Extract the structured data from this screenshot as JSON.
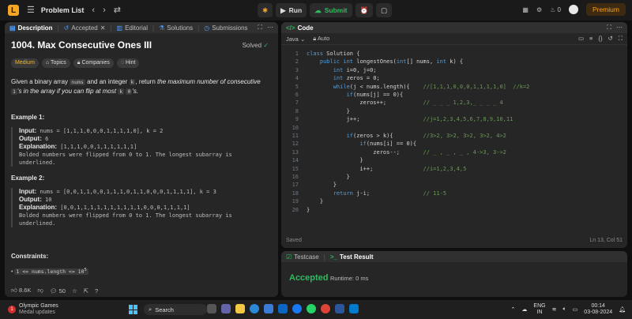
{
  "topbar": {
    "title": "Problem List",
    "run": "Run",
    "submit": "Submit",
    "streak": "0",
    "premium": "Premium"
  },
  "left": {
    "tabs": [
      "Description",
      "Accepted",
      "Editorial",
      "Solutions",
      "Submissions"
    ],
    "title": "1004. Max Consecutive Ones III",
    "solved": "Solved",
    "tags": [
      "Medium",
      "Topics",
      "Companies",
      "Hint"
    ],
    "desc_parts": [
      "Given a binary array ",
      "nums",
      " and an integer ",
      "k",
      ", return ",
      "the maximum number of consecutive ",
      "1",
      "'s in the array if you can flip at most ",
      "k",
      " ",
      "0",
      "'s."
    ],
    "ex1": {
      "head": "Example 1:",
      "input_label": "Input:",
      "input": "nums = [1,1,1,0,0,0,1,1,1,1,0], k = 2",
      "output_label": "Output:",
      "output": "6",
      "expl_label": "Explanation:",
      "expl": "[1,1,1,0,0,1,1,1,1,1,1]",
      "note": "Bolded numbers were flipped from 0 to 1. The longest subarray is underlined."
    },
    "ex2": {
      "head": "Example 2:",
      "input_label": "Input:",
      "input": "nums = [0,0,1,1,0,0,1,1,1,0,1,1,0,0,0,1,1,1,1], k = 3",
      "output_label": "Output:",
      "output": "10",
      "expl_label": "Explanation:",
      "expl": "[0,0,1,1,1,1,1,1,1,1,1,1,0,0,0,1,1,1,1]",
      "note": "Bolded numbers were flipped from 0 to 1. The longest subarray is underlined."
    },
    "constraints_head": "Constraints:",
    "constraint1": "1 <= nums.length <= 10",
    "constraint1_exp": "5",
    "likes": "8.6K",
    "comments": "50"
  },
  "code": {
    "title": "Code",
    "lang": "Java",
    "auto": "Auto",
    "lines": [
      {
        "n": "1",
        "t": "class Solution {"
      },
      {
        "n": "2",
        "t": "    public int longestOnes(int[] nums, int k) {"
      },
      {
        "n": "3",
        "t": "        int i=0, j=0;"
      },
      {
        "n": "4",
        "t": "        int zeros = 0;"
      },
      {
        "n": "5",
        "t": "        while(j < nums.length){    //[1,1,1,0,0,0,1,1,1,1,0]  //k=2"
      },
      {
        "n": "6",
        "t": "            if(nums[j] == 0){"
      },
      {
        "n": "7",
        "t": "                zeros++;           // _ _ _ 1,2,3,_ _ _ _ 4"
      },
      {
        "n": "8",
        "t": "            }"
      },
      {
        "n": "9",
        "t": "            j++;                   //j=1,2,3,4,5,6,7,8,9,10,11"
      },
      {
        "n": "10",
        "t": ""
      },
      {
        "n": "11",
        "t": "            if(zeros > k){         //3>2, 3>2, 3>2, 3>2, 4>2"
      },
      {
        "n": "12",
        "t": "                if(nums[i] == 0){"
      },
      {
        "n": "13",
        "t": "                    zeros--;       // _ , _ , _ , 4->3, 3->2"
      },
      {
        "n": "14",
        "t": "                }"
      },
      {
        "n": "15",
        "t": "                i++;               //i=1,2,3,4,5"
      },
      {
        "n": "16",
        "t": "            }"
      },
      {
        "n": "17",
        "t": "        }"
      },
      {
        "n": "18",
        "t": "        return j-i;                // 11-5"
      },
      {
        "n": "19",
        "t": "    }"
      },
      {
        "n": "20",
        "t": "}"
      }
    ],
    "saved": "Saved",
    "cursor": "Ln 13, Col 51"
  },
  "test": {
    "tab1": "Testcase",
    "tab2": "Test Result",
    "status": "Accepted",
    "runtime": "Runtime: 0 ms"
  },
  "taskbar": {
    "news1": "Olympic Games",
    "news2": "Medal updates",
    "search": "Search",
    "lang1": "ENG",
    "lang2": "IN",
    "time": "00:14",
    "date": "03-08-2024"
  }
}
